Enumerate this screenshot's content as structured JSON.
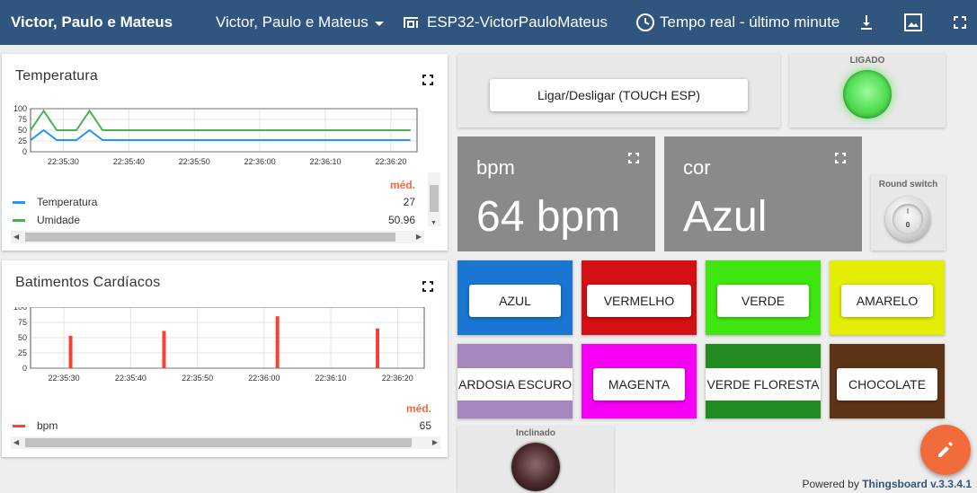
{
  "topbar": {
    "title": "Victor, Paulo e Mateus",
    "dashboard_select": "Victor, Paulo e Mateus",
    "device": "ESP32-VictorPauloMateus",
    "timewindow": "Tempo real - último minute",
    "icons": [
      "chevron-down-icon",
      "device-icon",
      "clock-icon",
      "download-icon",
      "image-export-icon",
      "fullscreen-icon"
    ]
  },
  "temp_card": {
    "title": "Temperatura",
    "med_label": "méd.",
    "legend": [
      {
        "name": "Temperatura",
        "avg": "27",
        "color": "#2196f3"
      },
      {
        "name": "Umidade",
        "avg": "50.96",
        "color": "#4caf50"
      }
    ]
  },
  "bpm_card": {
    "title": "Batimentos Cardíacos",
    "med_label": "méd.",
    "legend": [
      {
        "name": "bpm",
        "avg": "65",
        "color": "#f44336"
      }
    ]
  },
  "chart_data": [
    {
      "type": "line",
      "title": "Temperatura",
      "x": [
        "22:35:25",
        "22:35:27",
        "22:35:29",
        "22:35:31",
        "22:35:33",
        "22:35:35",
        "22:35:37",
        "22:35:39",
        "22:35:41",
        "22:35:43",
        "22:35:45",
        "22:35:47",
        "22:35:49",
        "22:35:51",
        "22:35:53",
        "22:35:55",
        "22:35:57",
        "22:35:59",
        "22:36:01",
        "22:36:03",
        "22:36:05",
        "22:36:07",
        "22:36:09",
        "22:36:11",
        "22:36:13",
        "22:36:15",
        "22:36:17",
        "22:36:19",
        "22:36:21",
        "22:36:23"
      ],
      "xticks": [
        "22:35:30",
        "22:35:40",
        "22:35:50",
        "22:36:00",
        "22:36:10",
        "22:36:20"
      ],
      "yticks": [
        0,
        25,
        50,
        75,
        100
      ],
      "ylim": [
        0,
        100
      ],
      "series": [
        {
          "name": "Temperatura",
          "color": "#2196f3",
          "values": [
            27,
            27,
            27,
            27,
            27,
            27,
            27,
            27,
            27,
            27,
            27,
            27,
            27,
            27,
            27,
            27,
            27,
            27,
            27,
            27,
            27,
            27,
            27,
            27,
            27,
            27,
            27,
            27,
            27,
            27
          ],
          "shape": [
            {
              "x": "22:35:25",
              "y": 27
            },
            {
              "x": "22:35:27",
              "y": 50
            },
            {
              "x": "22:35:29",
              "y": 27
            },
            {
              "x": "22:35:32",
              "y": 27
            },
            {
              "x": "22:35:34",
              "y": 50
            },
            {
              "x": "22:35:36",
              "y": 27
            },
            {
              "x": "22:36:23",
              "y": 27
            }
          ]
        },
        {
          "name": "Umidade",
          "color": "#4caf50",
          "values": [],
          "shape": [
            {
              "x": "22:35:25",
              "y": 50
            },
            {
              "x": "22:35:27",
              "y": 95
            },
            {
              "x": "22:35:29",
              "y": 50
            },
            {
              "x": "22:35:32",
              "y": 50
            },
            {
              "x": "22:35:34",
              "y": 95
            },
            {
              "x": "22:35:36",
              "y": 50
            },
            {
              "x": "22:36:23",
              "y": 50
            }
          ]
        }
      ]
    },
    {
      "type": "bar",
      "title": "Batimentos Cardíacos",
      "xticks": [
        "22:35:30",
        "22:35:40",
        "22:35:50",
        "22:36:00",
        "22:36:10",
        "22:36:20"
      ],
      "yticks": [
        0,
        25,
        50,
        75,
        100
      ],
      "ylim": [
        0,
        100
      ],
      "series": [
        {
          "name": "bpm",
          "color": "#f44336",
          "points": [
            {
              "x": "22:35:31",
              "y": 53
            },
            {
              "x": "22:35:45",
              "y": 61
            },
            {
              "x": "22:36:02",
              "y": 85
            },
            {
              "x": "22:36:17",
              "y": 65
            }
          ]
        }
      ]
    }
  ],
  "controls": {
    "toggle_button": "Ligar/Desligar (TOUCH ESP)",
    "led_label": "LIGADO",
    "round_switch_label": "Round switch",
    "round_switch_top": "I",
    "round_switch_bottom": "0",
    "tilt_label": "Inclinado"
  },
  "metrics": [
    {
      "label": "bpm",
      "value": "64 bpm"
    },
    {
      "label": "cor",
      "value": "Azul"
    }
  ],
  "colors": [
    {
      "label": "AZUL",
      "bg": "#1976d2"
    },
    {
      "label": "VERMELHO",
      "bg": "#d50f13"
    },
    {
      "label": "VERDE",
      "bg": "#3fe60f"
    },
    {
      "label": "AMARELO",
      "bg": "#e4ee04"
    },
    {
      "label": "ARDOSIA ESCURO",
      "bg": "#a686bf"
    },
    {
      "label": "MAGENTA",
      "bg": "#f600f6"
    },
    {
      "label": "VERDE FLORESTA",
      "bg": "#228b22"
    },
    {
      "label": "CHOCOLATE",
      "bg": "#5e3416"
    }
  ],
  "footer": {
    "powered_by": "Powered by",
    "brand": "Thingsboard v.3.3.4.1"
  }
}
